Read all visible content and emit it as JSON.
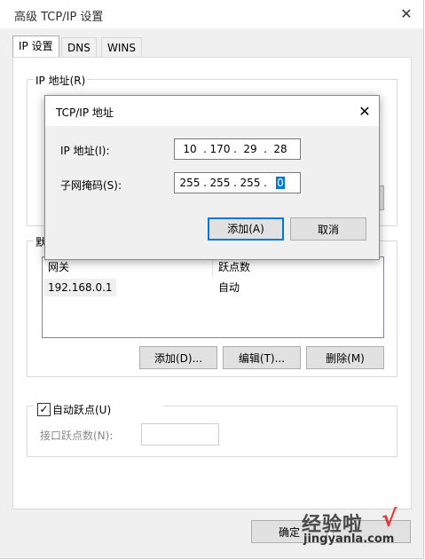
{
  "window": {
    "title": "高级 TCP/IP 设置"
  },
  "tabs": [
    {
      "label": "IP 设置",
      "active": true
    },
    {
      "label": "DNS",
      "active": false
    },
    {
      "label": "WINS",
      "active": false
    }
  ],
  "ip_group": {
    "label": "IP 地址(R)"
  },
  "gateway_group": {
    "label_partial": "默",
    "columns": [
      "网关",
      "跃点数"
    ],
    "rows": [
      {
        "gateway": "192.168.0.1",
        "metric": "自动"
      }
    ],
    "buttons": {
      "add": "添加(D)...",
      "edit": "编辑(T)...",
      "delete": "删除(M)"
    }
  },
  "auto_metric": {
    "label": "自动跃点(U)",
    "checked": true,
    "check_glyph": "✓"
  },
  "interface_metric": {
    "label": "接口跃点数(N):",
    "value": ""
  },
  "footer": {
    "ok": "确定"
  },
  "dialog": {
    "title": "TCP/IP 地址",
    "ip_label": "IP 地址(I):",
    "ip_octets": [
      "10",
      "170",
      "29",
      "28"
    ],
    "mask_label": "子网掩码(S):",
    "mask_octets": [
      "255",
      "255",
      "255",
      "0"
    ],
    "add_button": "添加(A)",
    "cancel_button": "取消"
  },
  "watermark": {
    "logo": "经验啦",
    "url": "jingyanla.com",
    "check": "√"
  },
  "icons": {
    "outer_close": "close-icon",
    "dialog_close": "close-icon"
  }
}
